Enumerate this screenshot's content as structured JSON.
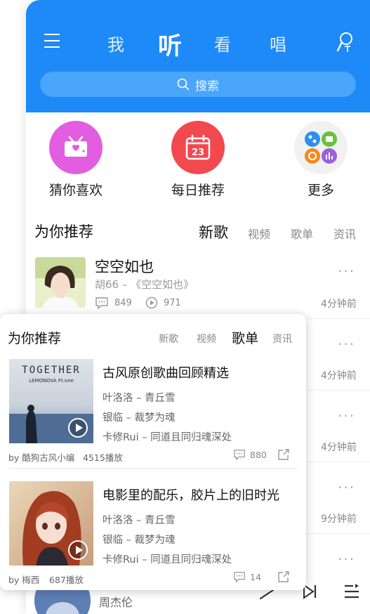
{
  "header": {
    "tabs": [
      {
        "label": "我"
      },
      {
        "label": "听"
      },
      {
        "label": "看"
      },
      {
        "label": "唱"
      }
    ],
    "active_tab": "听",
    "search_placeholder": "搜索",
    "brand_color": "#1e8af7"
  },
  "quick_links": [
    {
      "label": "猜你喜欢",
      "icon": "radio-heart-icon",
      "color": "#e35de0"
    },
    {
      "label": "每日推荐",
      "icon": "calendar-icon",
      "color": "#f2494f",
      "badge": "23"
    },
    {
      "label": "更多",
      "icon": "grid-apps-icon",
      "color": "#f0f0f0"
    }
  ],
  "recommend": {
    "title": "为你推荐",
    "tabs": [
      "新歌",
      "视频",
      "歌单",
      "资讯"
    ],
    "active_tab": "新歌",
    "songs": [
      {
        "title": "空空如也",
        "subtitle": "胡66 – 《空空如也》",
        "comments": "849",
        "plays": "971",
        "time": "4分钟前"
      },
      {
        "time": "4分钟前"
      },
      {
        "time": "4分钟前"
      },
      {
        "time": "9分钟前"
      }
    ],
    "more_label": "···"
  },
  "player": {
    "artist": "周杰伦"
  },
  "card": {
    "title": "为你推荐",
    "tabs": [
      "新歌",
      "视频",
      "歌单",
      "资讯"
    ],
    "active_tab": "歌单",
    "playlists": [
      {
        "title": "古风原创歌曲回顾精选",
        "cover_text_1": "TOGETHER",
        "cover_text_2": "LEMONOVA Ft.one",
        "songs": [
          "叶洛洛 – 青丘雪",
          "银临 – 裁梦为魂",
          "卡修Rui – 同道且同归魂深处"
        ],
        "by": "by 酷狗古风小编",
        "plays": "4515播放",
        "comments": "880"
      },
      {
        "title": "电影里的配乐，胶片上的旧时光",
        "songs": [
          "叶洛洛 – 青丘雪",
          "银临 – 裁梦为魂",
          "卡修Rui – 同道且同归魂深处"
        ],
        "by": "by 梅西",
        "plays": "687播放",
        "comments": "14"
      }
    ]
  }
}
